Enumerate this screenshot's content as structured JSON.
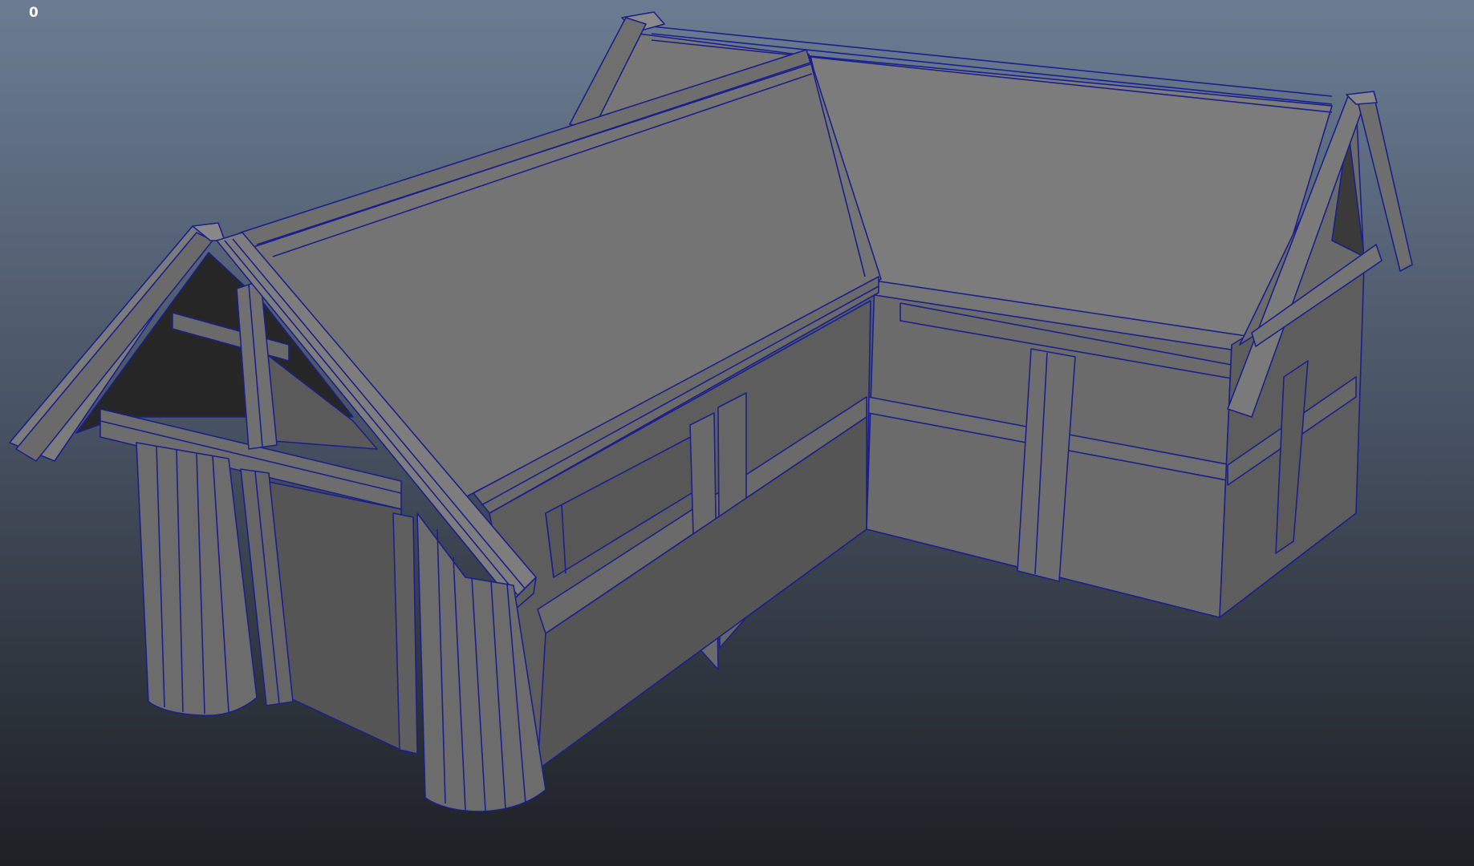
{
  "viewport": {
    "frame_counter": "0",
    "background_gradient": [
      "#6b7c92",
      "#1d2024"
    ],
    "wireframe_color": "#1a1f8c",
    "shaded_color": "#7a7a7a"
  }
}
